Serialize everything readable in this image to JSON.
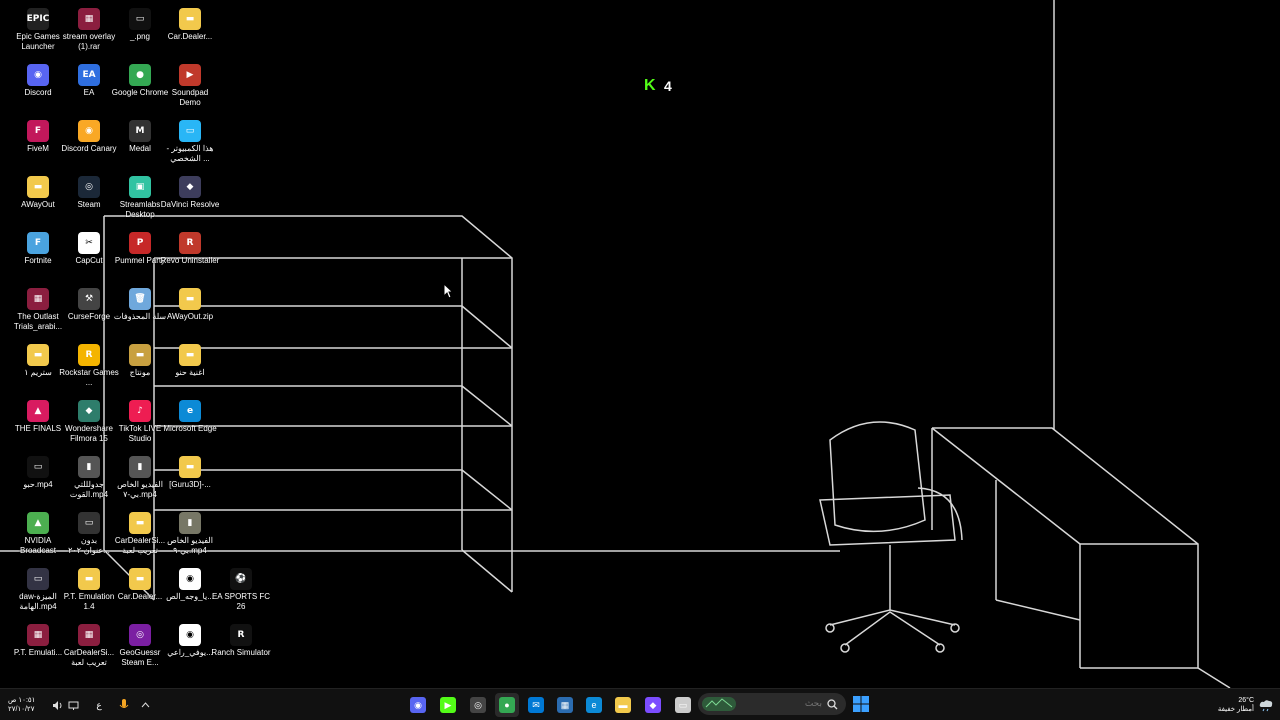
{
  "desktop": {
    "icons": [
      {
        "label": "Epic Games Launcher",
        "color": "#222222",
        "glyph": "EPIC"
      },
      {
        "label": "stream overlay (1).rar",
        "color": "#8b1e3f",
        "glyph": "▦"
      },
      {
        "label": "_.png",
        "color": "#111111",
        "glyph": "▭"
      },
      {
        "label": "Car.Dealer...",
        "color": "#f2c94c",
        "glyph": "▬"
      },
      {
        "label": "Discord",
        "color": "#5865f2",
        "glyph": "◉"
      },
      {
        "label": "EA",
        "color": "#2f6fe0",
        "glyph": "EA"
      },
      {
        "label": "Google Chrome",
        "color": "#34a853",
        "glyph": "●"
      },
      {
        "label": "Soundpad Demo",
        "color": "#c0392b",
        "glyph": "▶"
      },
      {
        "label": "FiveM",
        "color": "#c2185b",
        "glyph": "F"
      },
      {
        "label": "Discord Canary",
        "color": "#f9a825",
        "glyph": "◉"
      },
      {
        "label": "Medal",
        "color": "#333333",
        "glyph": "M"
      },
      {
        "label": "هذا الكمبيوتر - الشخصي ...",
        "color": "#29b6f6",
        "glyph": "▭"
      },
      {
        "label": "AWayOut",
        "color": "#f2c94c",
        "glyph": "▬"
      },
      {
        "label": "Steam",
        "color": "#1b2838",
        "glyph": "◎"
      },
      {
        "label": "Streamlabs Desktop",
        "color": "#31c3a2",
        "glyph": "▣"
      },
      {
        "label": "DaVinci Resolve",
        "color": "#3d3d5c",
        "glyph": "◆"
      },
      {
        "label": "Fortnite",
        "color": "#4aa3df",
        "glyph": "F"
      },
      {
        "label": "CapCut",
        "color": "#ffffff",
        "glyph": "✂"
      },
      {
        "label": "Pummel Party",
        "color": "#c62828",
        "glyph": "P"
      },
      {
        "label": "Revo Uninstaller",
        "color": "#c0392b",
        "glyph": "R"
      },
      {
        "label": "The Outlast Trials_arabi...",
        "color": "#8b1e3f",
        "glyph": "▦"
      },
      {
        "label": "CurseForge",
        "color": "#444444",
        "glyph": "⚒"
      },
      {
        "label": "سلة المحذوفات",
        "color": "#6fa8dc",
        "glyph": "🗑"
      },
      {
        "label": "AWayOut.zip",
        "color": "#f2c94c",
        "glyph": "▬"
      },
      {
        "label": "ستريم ١",
        "color": "#f2c94c",
        "glyph": "▬"
      },
      {
        "label": "Rockstar Games ...",
        "color": "#f4b400",
        "glyph": "R"
      },
      {
        "label": "مونتاج",
        "color": "#c8a040",
        "glyph": "▬"
      },
      {
        "label": "اغنية حنو",
        "color": "#f2c94c",
        "glyph": "▬"
      },
      {
        "label": "THE FINALS",
        "color": "#d81b60",
        "glyph": "▲"
      },
      {
        "label": "Wondershare Filmora 15",
        "color": "#2e7d6b",
        "glyph": "◆"
      },
      {
        "label": "TikTok LIVE Studio",
        "color": "#ee1d52",
        "glyph": "♪"
      },
      {
        "label": "Microsoft Edge",
        "color": "#0c8ad6",
        "glyph": "e"
      },
      {
        "label": "حبو.mp4",
        "color": "#111111",
        "glyph": "▭"
      },
      {
        "label": "جدولللتي القوت.mp4",
        "color": "#555555",
        "glyph": "▮"
      },
      {
        "label": "الفيديو الخاص بي-٧.mp4",
        "color": "#555555",
        "glyph": "▮"
      },
      {
        "label": "[Guru3D]-...",
        "color": "#f2c94c",
        "glyph": "▬"
      },
      {
        "label": "NVIDIA Broadcast",
        "color": "#4caf50",
        "glyph": "▲"
      },
      {
        "label": "بدون عنوان-٢٠٢...",
        "color": "#333333",
        "glyph": "▭"
      },
      {
        "label": "CarDealerSi... تعريب لعبة",
        "color": "#f2c94c",
        "glyph": "▬"
      },
      {
        "label": "الفيديو الخاص بي-٩.mp4",
        "color": "#777766",
        "glyph": "▮"
      },
      {
        "label": "daw-الميزة الهامة.mp4",
        "color": "#333344",
        "glyph": "▭"
      },
      {
        "label": "P.T. Emulation 1.4",
        "color": "#f2c94c",
        "glyph": "▬"
      },
      {
        "label": "Car.Dealer...",
        "color": "#f2c94c",
        "glyph": "▬"
      },
      {
        "label": "يا_وجه_الص...",
        "color": "#ffffff",
        "glyph": "◉"
      },
      {
        "label": "EA SPORTS FC 26",
        "color": "#111111",
        "glyph": "⚽"
      },
      {
        "label": "P.T. Emulati...",
        "color": "#8b1e3f",
        "glyph": "▦"
      },
      {
        "label": "CarDealerSi... تعريب لعبة",
        "color": "#8b1e3f",
        "glyph": "▦"
      },
      {
        "label": "GeoGuessr Steam E...",
        "color": "#7b1fa2",
        "glyph": "◎"
      },
      {
        "label": "يوفي_راعي...",
        "color": "#ffffff",
        "glyph": "◉"
      },
      {
        "label": "Ranch Simulator",
        "color": "#111111",
        "glyph": "R"
      }
    ]
  },
  "widget": {
    "count": "4",
    "accent": "#53fc18"
  },
  "taskbar": {
    "search_placeholder": "بحث",
    "tray_time": "١٠:٥١ ص",
    "tray_date": "٢٧/١٠/٢٧",
    "language": "ع",
    "weather_temp": "26°C",
    "weather_desc": "أمطار خفيفة",
    "pinned_apps": [
      {
        "name": "discord-app-icon",
        "color": "#5865f2",
        "glyph": "◉"
      },
      {
        "name": "kick-app-icon",
        "color": "#53fc18",
        "glyph": "▶"
      },
      {
        "name": "obs-app-icon",
        "color": "#444444",
        "glyph": "◎"
      },
      {
        "name": "chrome-app-icon",
        "color": "#34a853",
        "glyph": "●"
      },
      {
        "name": "mail-app-icon",
        "color": "#0078d4",
        "glyph": "✉"
      },
      {
        "name": "store-app-icon",
        "color": "#2b6cb0",
        "glyph": "▦"
      },
      {
        "name": "edge-app-icon",
        "color": "#0c8ad6",
        "glyph": "e"
      },
      {
        "name": "file-explorer-icon",
        "color": "#f2c94c",
        "glyph": "▬"
      },
      {
        "name": "copilot-app-icon",
        "color": "#7c4dff",
        "glyph": "◆"
      },
      {
        "name": "task-view-icon",
        "color": "#cccccc",
        "glyph": "▭"
      }
    ]
  }
}
